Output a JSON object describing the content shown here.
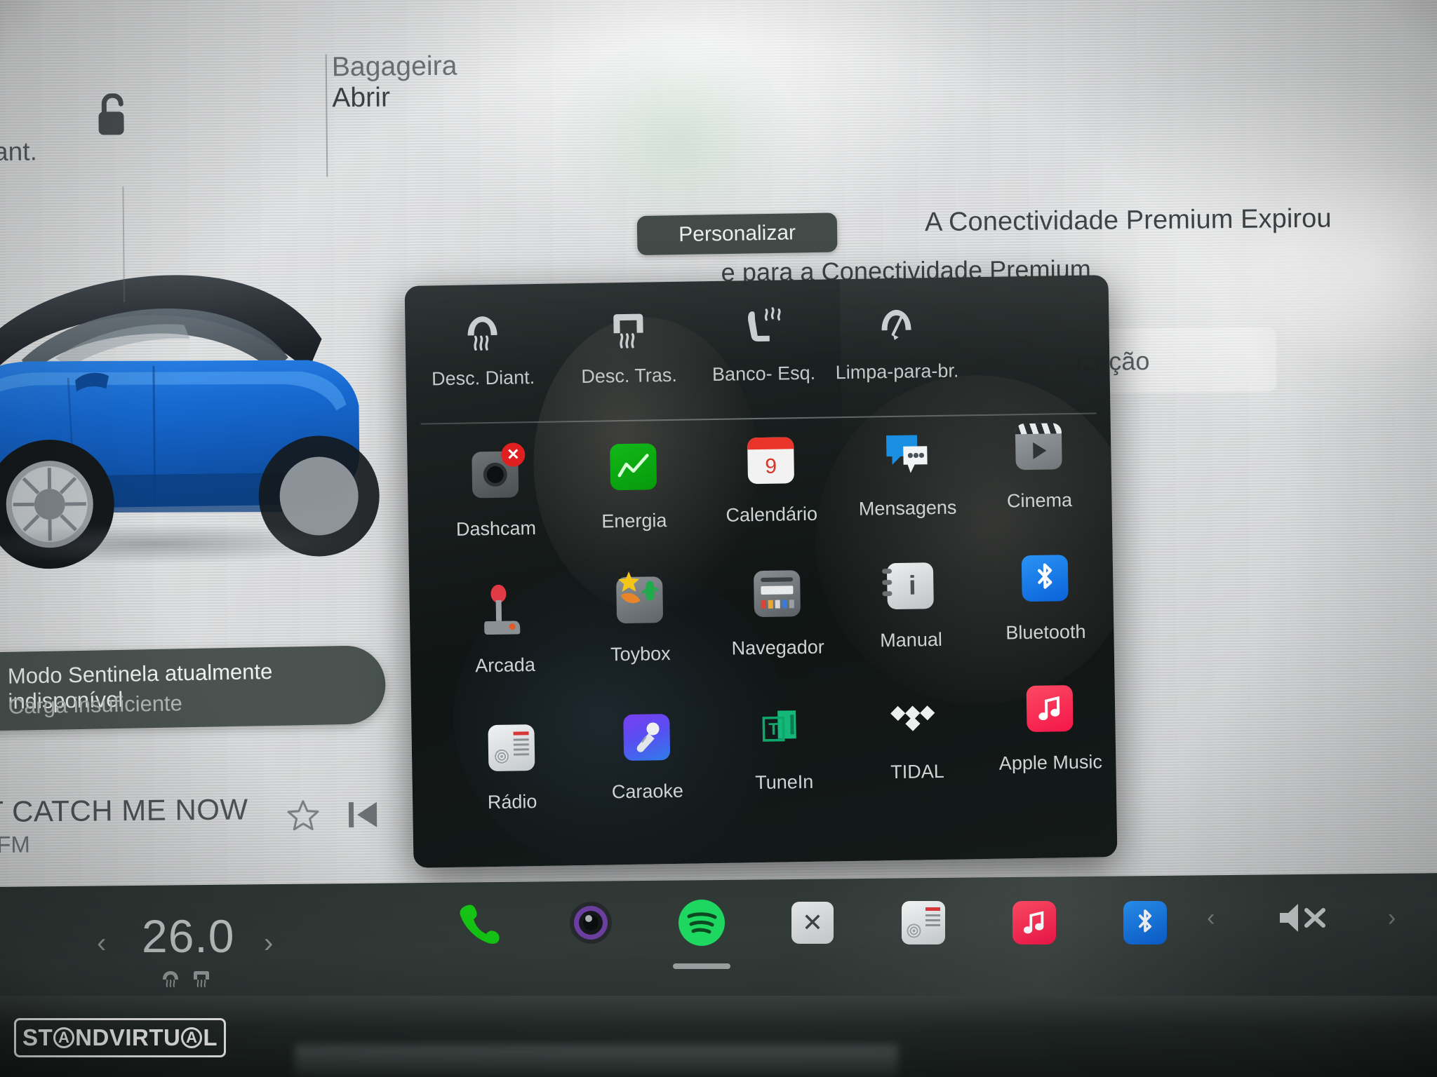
{
  "background_ui": {
    "truncated_left_text": "diant.",
    "trunk": {
      "title": "Bagageira",
      "action": "Abrir"
    },
    "lock_icon": "unlocked-padlock-icon",
    "personalizar_button": "Personalizar",
    "connectivity": {
      "title": "A Conectividade Premium Expirou",
      "subtitle": "e para a Conectividade Premium",
      "secondary": "ização"
    },
    "sentinel": {
      "line1": "Modo Sentinela atualmente indisponível",
      "line2": "Carga insuficiente"
    },
    "now_playing": {
      "title": "'T CATCH ME NOW",
      "station": "RFM",
      "favorite_icon": "star-icon",
      "prev_icon": "previous-track-icon"
    }
  },
  "launcher": {
    "climate": [
      {
        "label": "Desc. Diant.",
        "icon": "front-defrost-icon"
      },
      {
        "label": "Desc. Tras.",
        "icon": "rear-defrost-icon"
      },
      {
        "label": "Banco- Esq.",
        "icon": "seat-heater-left-icon"
      },
      {
        "label": "Limpa-para-br.",
        "icon": "windshield-wiper-icon"
      }
    ],
    "apps": [
      {
        "label": "Dashcam",
        "icon": "dashcam-icon",
        "badge": "x",
        "badge_color": "#e02020"
      },
      {
        "label": "Energia",
        "icon": "energy-icon",
        "color": "#0ba313"
      },
      {
        "label": "Calendário",
        "icon": "calendar-icon",
        "color": "#ffffff",
        "day": "9"
      },
      {
        "label": "Mensagens",
        "icon": "messages-icon",
        "color": "#1a8ee0"
      },
      {
        "label": "Cinema",
        "icon": "theater-icon",
        "color": "#8b9093"
      },
      {
        "label": "Arcada",
        "icon": "arcade-joystick-icon",
        "color": "#d8363a"
      },
      {
        "label": "Toybox",
        "icon": "toybox-icon",
        "color": "#7a7f82"
      },
      {
        "label": "Navegador",
        "icon": "browser-icon",
        "color": "#7a7f82"
      },
      {
        "label": "Manual",
        "icon": "manual-notebook-icon",
        "color": "#d8dadb"
      },
      {
        "label": "Bluetooth",
        "icon": "bluetooth-icon",
        "color": "#1076e8"
      },
      {
        "label": "Rádio",
        "icon": "radio-icon",
        "color": "#e2e4e5"
      },
      {
        "label": "Caraoke",
        "icon": "karaoke-microphone-icon",
        "color": "#6a4df0"
      },
      {
        "label": "TuneIn",
        "icon": "tunein-icon",
        "color": "#10b981"
      },
      {
        "label": "TIDAL",
        "icon": "tidal-icon",
        "color": "#ffffff"
      },
      {
        "label": "Apple Music",
        "icon": "apple-music-icon",
        "color": "#fa2d48"
      }
    ]
  },
  "dock": {
    "temperature": {
      "value": "26.0",
      "left_chevron": "‹",
      "right_chevron": "›"
    },
    "apps": [
      {
        "name": "phone-icon",
        "color": "#15c415"
      },
      {
        "name": "camera-icon",
        "color": "#6b3fa0"
      },
      {
        "name": "spotify-icon",
        "color": "#1ed760",
        "active": true
      },
      {
        "name": "close-icon",
        "color": "#d9dbdc"
      },
      {
        "name": "radio-icon",
        "color": "#e2e4e5"
      },
      {
        "name": "apple-music-icon",
        "color": "#fa2d48"
      },
      {
        "name": "bluetooth-icon",
        "color": "#1076e8"
      }
    ],
    "volume": {
      "icon": "volume-muted-icon",
      "left_chevron": "‹",
      "right_chevron": "›"
    }
  },
  "watermark": {
    "part1": "ST",
    "a1": "A",
    "part2": "NDVIRTU",
    "a2": "A",
    "part3": "L"
  }
}
